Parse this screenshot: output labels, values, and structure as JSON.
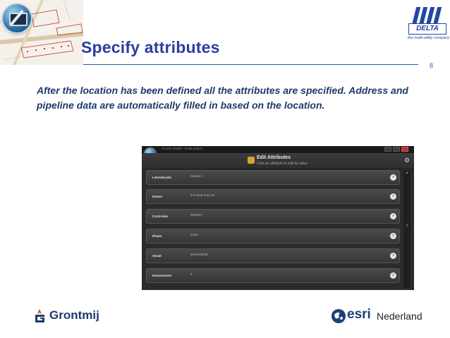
{
  "slide": {
    "title": "Specify attributes",
    "page_number": "8",
    "body": "After the location has been defined all the attributes are specified. Address and pipeline data are automatically filled in based on the location."
  },
  "delta": {
    "word": "DELTA",
    "tagline": "the multi-utility company"
  },
  "app": {
    "window_title": "ArcGIS Mobile - Delta project",
    "header_title": "Edit Attributes",
    "header_subtitle": "Click an attribute to edit its value",
    "rows": [
      {
        "label": "Lekmelicatie",
        "value": "Klasse 1"
      },
      {
        "label": "Datum",
        "value": "8-9-2011 8:41:43"
      },
      {
        "label": "Controleur",
        "value": "MG3027"
      },
      {
        "label": "Plaats",
        "value": "Goes"
      },
      {
        "label": "Straat",
        "value": "Brumestraat"
      },
      {
        "label": "Huisnummer",
        "value": "2"
      }
    ]
  },
  "footer": {
    "grontmij": "Grontmij",
    "esri": "esri",
    "esri_region": "Nederland"
  },
  "colors": {
    "title": "#2a3ea0",
    "body": "#1f3a6b",
    "brand": "#2247a0"
  }
}
